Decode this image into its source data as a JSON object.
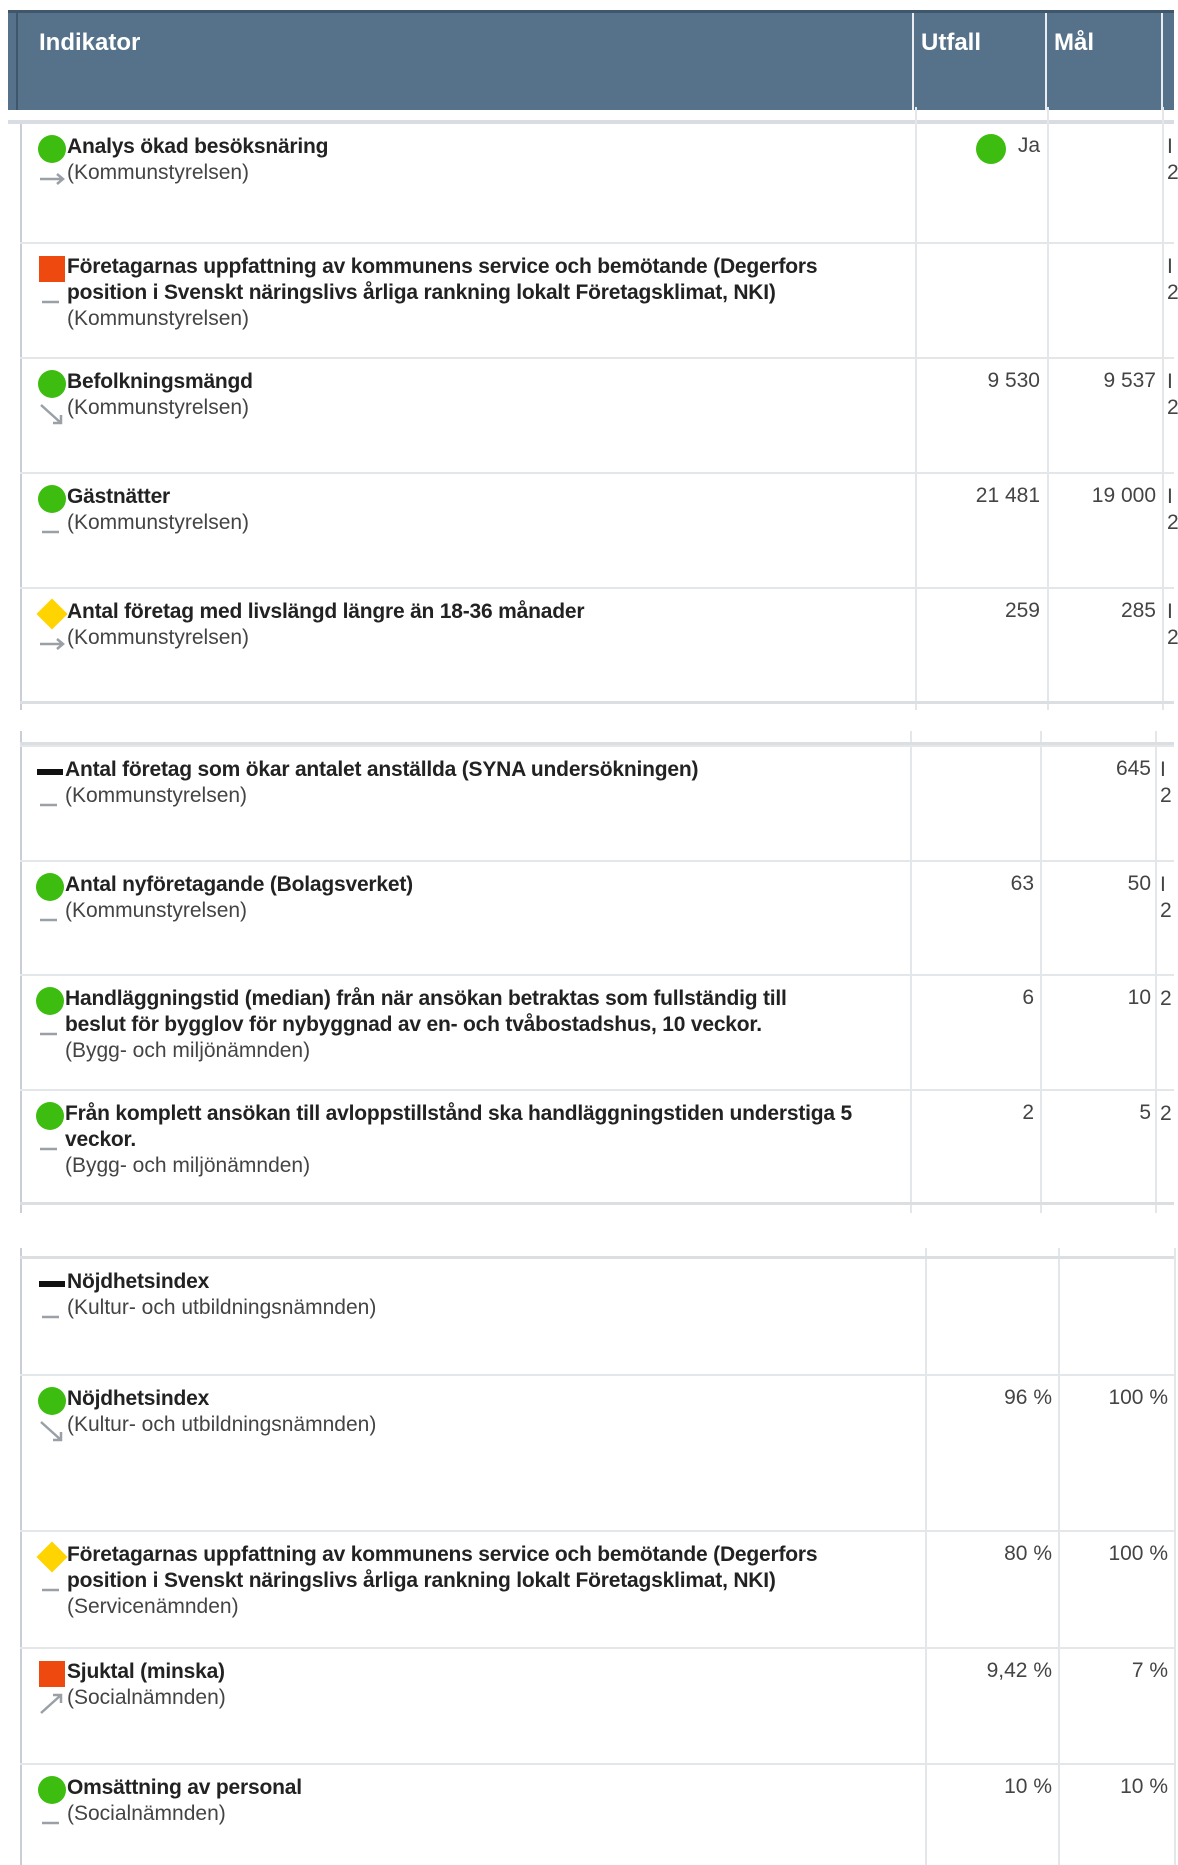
{
  "header": {
    "indikator": "Indikator",
    "utfall": "Utfall",
    "mal": "Mål"
  },
  "colors": {
    "header_bg": "#56728a",
    "green": "#3dbd10",
    "red": "#ee4a10",
    "yellow": "#ffd400",
    "black": "#111111"
  },
  "rows1": [
    {
      "status": "green",
      "trend": "right-arrow",
      "title": "Analys ökad besöksnäring",
      "owner": "(Kommunstyrelsen)",
      "utfall_icon": "green",
      "utfall": "Ja",
      "mal": "",
      "cut1": "I",
      "cut2": "2"
    },
    {
      "status": "red",
      "trend": "dash",
      "title": "Företagarnas uppfattning av kommunens service och bemötande (Degerfors",
      "title2": "position i Svenskt näringslivs årliga rankning lokalt Företagsklimat, NKI)",
      "owner": "(Kommunstyrelsen)",
      "utfall": "",
      "mal": "",
      "cut1": "I",
      "cut2": "2"
    },
    {
      "status": "green",
      "trend": "down-arrow",
      "title": "Befolkningsmängd",
      "owner": "(Kommunstyrelsen)",
      "utfall": "9 530",
      "mal": "9 537",
      "cut1": "I",
      "cut2": "2"
    },
    {
      "status": "green",
      "trend": "dash",
      "title": "Gästnätter",
      "owner": "(Kommunstyrelsen)",
      "utfall": "21 481",
      "mal": "19 000",
      "cut1": "I",
      "cut2": "2"
    },
    {
      "status": "yellow",
      "trend": "right-arrow",
      "title": "Antal företag med livslängd längre än 18-36 månader",
      "owner": "(Kommunstyrelsen)",
      "utfall": "259",
      "mal": "285",
      "cut1": "I",
      "cut2": "2"
    }
  ],
  "rows2": [
    {
      "status": "black",
      "trend": "dash",
      "title": "Antal företag som ökar antalet anställda (SYNA undersökningen)",
      "owner": "(Kommunstyrelsen)",
      "utfall": "",
      "mal": "645",
      "cut1": "I",
      "cut2": "2"
    },
    {
      "status": "green",
      "trend": "dash",
      "title": "Antal nyföretagande (Bolagsverket)",
      "owner": "(Kommunstyrelsen)",
      "utfall": "63",
      "mal": "50",
      "cut1": "I",
      "cut2": "2"
    },
    {
      "status": "green",
      "trend": "dash",
      "title": "Handläggningstid (median) från när ansökan betraktas som fullständig till",
      "title2": "beslut för bygglov för nybyggnad av en- och tvåbostadshus, 10 veckor.",
      "owner": "(Bygg- och miljönämnden)",
      "utfall": "6",
      "mal": "10",
      "cut1": "2",
      "cut2": ""
    },
    {
      "status": "green",
      "trend": "dash",
      "title": "Från komplett ansökan till avloppstillstånd ska handläggningstiden understiga 5",
      "title2": "veckor.",
      "owner": "(Bygg- och miljönämnden)",
      "utfall": "2",
      "mal": "5",
      "cut1": "2",
      "cut2": ""
    }
  ],
  "rows3": [
    {
      "status": "black",
      "trend": "dash",
      "title": "Nöjdhetsindex",
      "owner": "(Kultur- och utbildningsnämnden)",
      "utfall": "",
      "mal": ""
    },
    {
      "status": "green",
      "trend": "down-arrow",
      "title": "Nöjdhetsindex",
      "owner": "(Kultur- och utbildningsnämnden)",
      "utfall": "96 %",
      "mal": "100 %"
    },
    {
      "status": "yellow",
      "trend": "dash",
      "title": "Företagarnas uppfattning av kommunens service och bemötande (Degerfors",
      "title2": "position i Svenskt näringslivs årliga rankning lokalt Företagsklimat, NKI)",
      "owner": "(Servicenämnden)",
      "utfall": "80 %",
      "mal": "100 %"
    },
    {
      "status": "red",
      "trend": "up-arrow",
      "title": "Sjuktal (minska)",
      "owner": "(Socialnämnden)",
      "utfall": "9,42 %",
      "mal": "7 %"
    },
    {
      "status": "green",
      "trend": "dash",
      "title": "Omsättning av personal",
      "owner": "(Socialnämnden)",
      "utfall": "10 %",
      "mal": "10 %"
    }
  ]
}
